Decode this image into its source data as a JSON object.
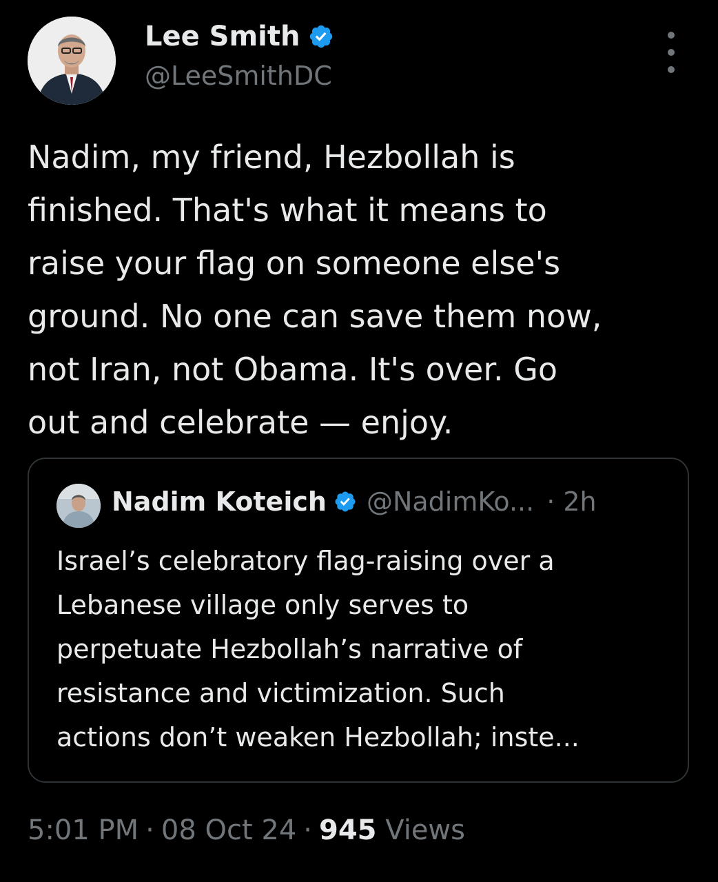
{
  "author": {
    "display_name": "Lee Smith",
    "handle": "@LeeSmithDC",
    "verified": true
  },
  "tweet": {
    "text_lines": [
      "Nadim, my friend, Hezbollah is",
      "finished. That's what it means to",
      "raise your flag on someone else's",
      "ground. No one can save them now,",
      "not Iran, not Obama. It's over. Go",
      "out and celebrate — enjoy."
    ]
  },
  "quote": {
    "display_name": "Nadim Koteich",
    "handle": "@NadimKo...",
    "time": "· 2h",
    "verified": true,
    "text_lines": [
      "Israel’s celebratory flag-raising over a",
      "Lebanese village only serves to",
      "perpetuate Hezbollah’s narrative of",
      "resistance and victimization. Such",
      "actions don’t weaken Hezbollah; inste..."
    ]
  },
  "meta": {
    "time": "5:01 PM",
    "date": "08 Oct 24",
    "separator": "·",
    "views_count": "945",
    "views_label": "Views"
  },
  "colors": {
    "background": "#000000",
    "primary_text": "#e7e9ea",
    "secondary_text": "#71767b",
    "verified_badge": "#1d9bf0",
    "border": "#2f3336"
  },
  "icons": {
    "verified": "verified-badge-icon",
    "more": "more-options-icon"
  }
}
